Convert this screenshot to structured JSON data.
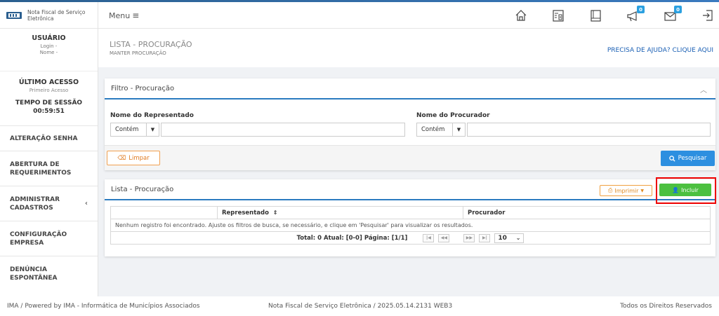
{
  "app": {
    "logo_line1": "Nota Fiscal de Serviço",
    "logo_line2": "Eletrônica"
  },
  "header": {
    "menu_label": "Menu",
    "mail_badge": "0",
    "megaphone_badge": "0"
  },
  "user": {
    "title": "USUÁRIO",
    "login": "Login -",
    "name": "Nome -"
  },
  "access": {
    "title": "ÚLTIMO ACESSO",
    "sub": "Primeiro Acesso",
    "session_title": "TEMPO DE SESSÃO",
    "session_time": "00:59:51"
  },
  "sidebar": {
    "items": [
      {
        "label": "ALTERAÇÃO SENHA"
      },
      {
        "label": "ABERTURA DE REQUERIMENTOS"
      },
      {
        "label": "ADMINISTRAR CADASTROS"
      },
      {
        "label": "CONFIGURAÇÃO EMPRESA"
      },
      {
        "label": "DENÚNCIA ESPONTÂNEA"
      }
    ]
  },
  "page": {
    "title": "LISTA - PROCURAÇÃO",
    "subtitle": "MANTER PROCURAÇÃO",
    "help": "PRECISA DE AJUDA? CLIQUE AQUI"
  },
  "filter": {
    "title": "Filtro - Procuração",
    "representado_label": "Nome do Representado",
    "procurador_label": "Nome do Procurador",
    "representado_mode": "Contém",
    "procurador_mode": "Contém",
    "clear_label": "Limpar",
    "search_label": "Pesquisar"
  },
  "list": {
    "title": "Lista - Procuração",
    "print_label": "Imprimir",
    "add_label": "Incluir",
    "columns": [
      "",
      "Representado",
      "Procurador"
    ],
    "empty_message": "Nenhum registro foi encontrado. Ajuste os filtros de busca, se necessário, e clique em 'Pesquisar' para visualizar os resultados.",
    "pager_text": "Total: 0 Atual: [0-0] Página: [1/1]",
    "page_size": "10"
  },
  "footer": {
    "left": "IMA / Powered by IMA - Informática de Municípios Associados",
    "middle": "Nota Fiscal de Serviço Eletrônica / 2025.05.14.2131 WEB3",
    "right": "Todos os Direitos Reservados"
  },
  "colors": {
    "primary": "#2b7bc0",
    "search": "#2d8fe0",
    "add": "#4cc040",
    "clear": "#e07b20",
    "highlight": "#e00000"
  }
}
